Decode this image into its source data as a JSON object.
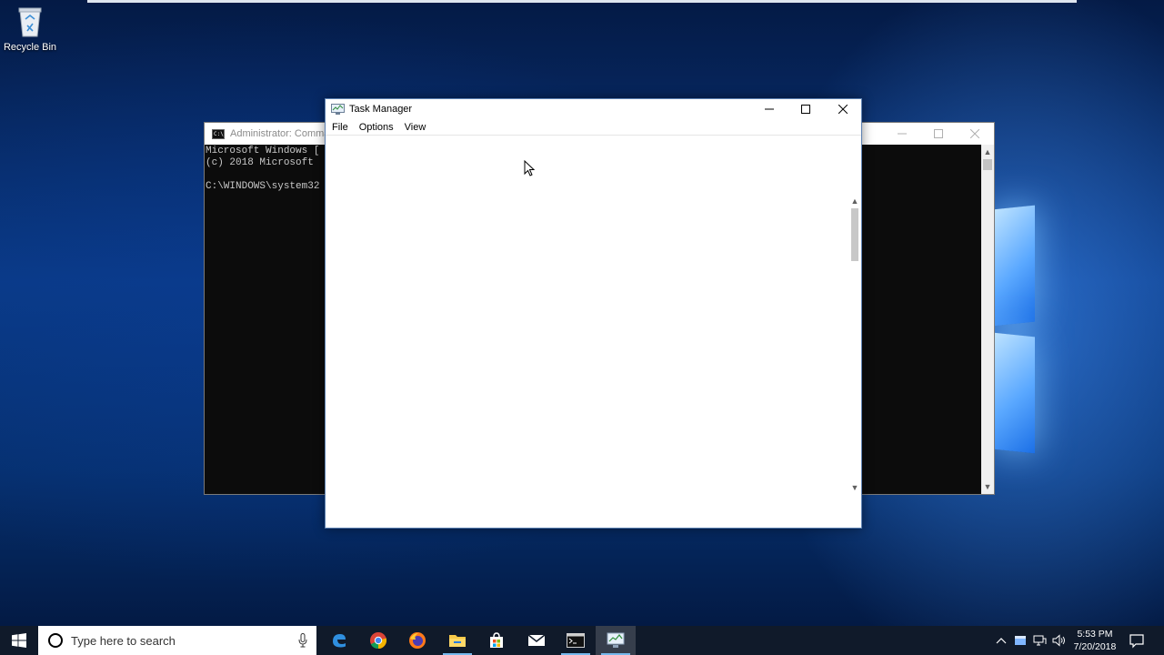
{
  "desktop": {
    "recycle_bin_label": "Recycle Bin"
  },
  "cmd_window": {
    "title": "Administrator: Comma",
    "lines": [
      "Microsoft Windows [",
      "(c) 2018 Microsoft ",
      "",
      "C:\\WINDOWS\\system32"
    ]
  },
  "task_manager": {
    "title": "Task Manager",
    "menu": {
      "file": "File",
      "options": "Options",
      "view": "View"
    }
  },
  "taskbar": {
    "search_placeholder": "Type here to search",
    "pinned_apps": [
      "edge-icon",
      "chrome-icon",
      "firefox-icon",
      "file-explorer-icon",
      "store-icon",
      "mail-icon",
      "command-prompt-icon",
      "task-manager-icon"
    ],
    "clock": {
      "time": "5:53 PM",
      "date": "7/20/2018"
    }
  },
  "colors": {
    "taskbar": "#101a2a",
    "running_indicator": "#76b9ed",
    "cmd_background": "#0c0c0c"
  }
}
